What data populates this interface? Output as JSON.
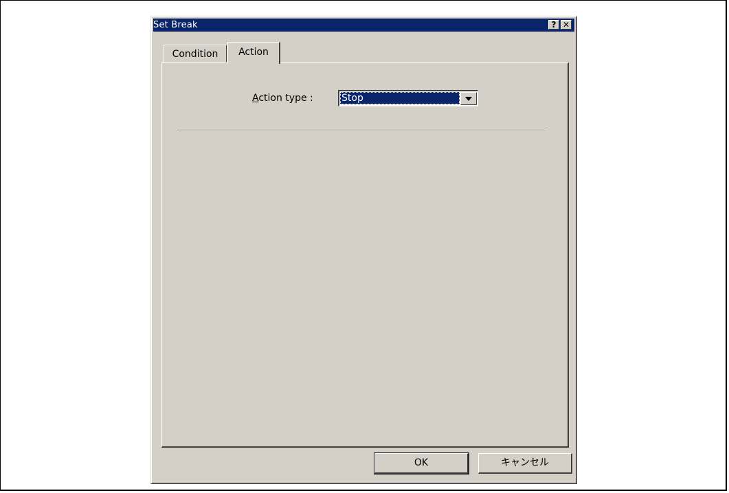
{
  "dialog": {
    "title": "Set Break",
    "help_glyph": "?",
    "close_glyph": "✕"
  },
  "tabs": [
    {
      "label": "Condition",
      "active": false
    },
    {
      "label": "Action",
      "active": true
    }
  ],
  "action": {
    "label": "Action type :",
    "selected_value": "Stop"
  },
  "buttons": {
    "ok_label": "OK",
    "cancel_label": "キャンセル"
  },
  "colors": {
    "titlebar": "#0a246a",
    "face": "#d4d0c8",
    "selection": "#0a246a"
  }
}
